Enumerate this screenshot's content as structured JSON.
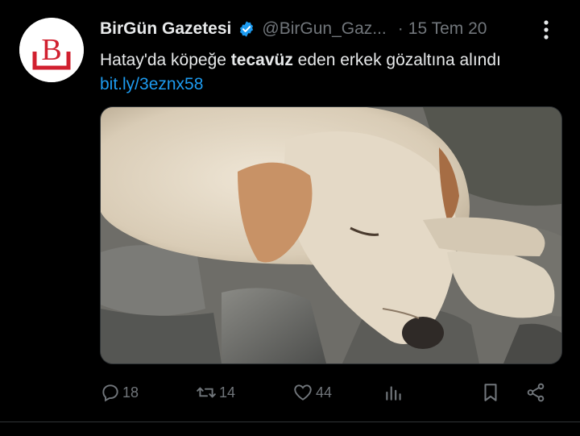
{
  "account": {
    "display_name": "BirGün Gazetesi",
    "handle": "@BirGun_Gaz...",
    "separator": "·",
    "date": "15 Tem 20",
    "logo_letter": "B",
    "verified_icon": "verified-badge-icon",
    "colors": {
      "logo_red": "#d1202f",
      "verified_blue": "#1d9bf0"
    }
  },
  "tweet": {
    "text_before": "Hatay'da köpeğe ",
    "text_bold": "tecavüz",
    "text_after": " eden erkek gözaltına alındı",
    "link": "bit.ly/3eznx58",
    "media_icon": "sleeping-dog-photo"
  },
  "actions": {
    "reply_count": "18",
    "retweet_count": "14",
    "like_count": "44",
    "icons": [
      "reply-icon",
      "retweet-icon",
      "like-icon",
      "views-icon",
      "bookmark-icon",
      "share-icon"
    ]
  },
  "theme": {
    "background": "#000000",
    "text": "#e7e9ea",
    "muted": "#71767b",
    "link": "#1d9bf0"
  }
}
